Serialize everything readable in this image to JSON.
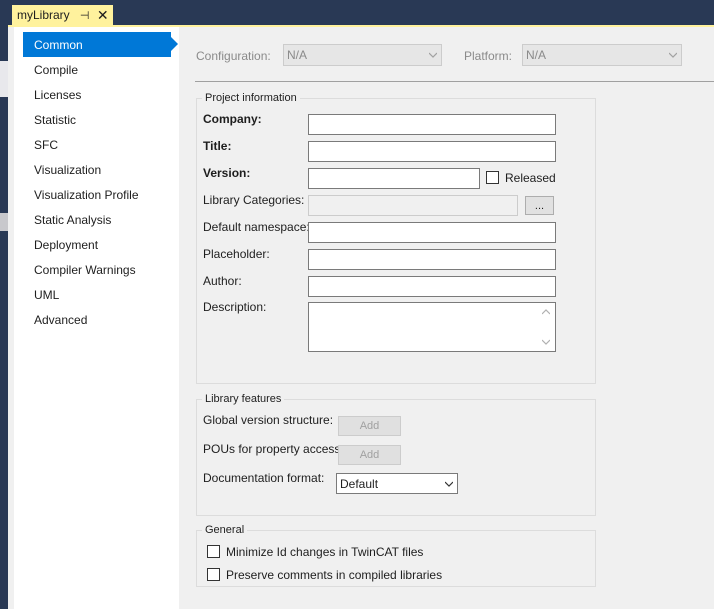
{
  "tab": {
    "title": "myLibrary",
    "pin_glyph": "⊣",
    "close_glyph": "✕"
  },
  "nav": {
    "items": [
      {
        "label": "Common"
      },
      {
        "label": "Compile"
      },
      {
        "label": "Licenses"
      },
      {
        "label": "Statistic"
      },
      {
        "label": "SFC"
      },
      {
        "label": "Visualization"
      },
      {
        "label": "Visualization Profile"
      },
      {
        "label": "Static Analysis"
      },
      {
        "label": "Deployment"
      },
      {
        "label": "Compiler Warnings"
      },
      {
        "label": "UML"
      },
      {
        "label": "Advanced"
      }
    ],
    "selected": "Common"
  },
  "config": {
    "configuration_label": "Configuration:",
    "configuration_value": "N/A",
    "platform_label": "Platform:",
    "platform_value": "N/A"
  },
  "project_info": {
    "title": "Project information",
    "company_label": "Company:",
    "company_value": "",
    "title_label": "Title:",
    "title_value": "",
    "version_label": "Version:",
    "version_value": "",
    "released_label": "Released",
    "categories_label": "Library Categories:",
    "categories_button": "...",
    "namespace_label": "Default namespace:",
    "placeholder_label": "Placeholder:",
    "author_label": "Author:",
    "description_label": "Description:"
  },
  "features": {
    "title": "Library features",
    "global_version_label": "Global version structure:",
    "pous_label": "POUs for property access:",
    "add_label": "Add",
    "doc_format_label": "Documentation format:",
    "doc_format_value": "Default"
  },
  "general": {
    "title": "General",
    "minimize_label": "Minimize Id changes in TwinCAT files",
    "preserve_label": "Preserve comments in compiled libraries"
  },
  "colors": {
    "accent": "#0078d7",
    "tab": "#fff29d",
    "chrome": "#293955"
  }
}
